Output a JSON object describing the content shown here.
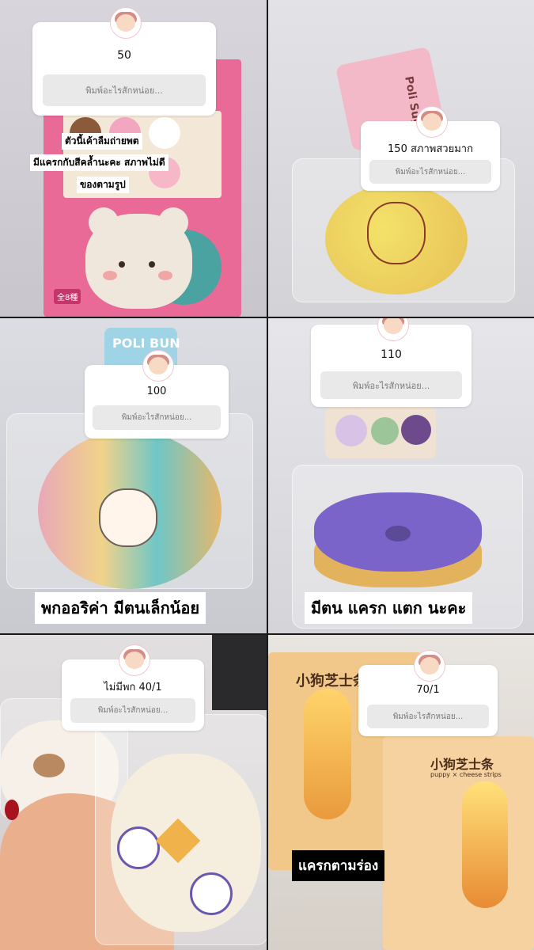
{
  "panels": [
    {
      "answer": "50",
      "placeholder": "พิมพ์อะไรสักหน่อย...",
      "captions": [
        "ตัวนี้เค้าลืมถ่ายพต",
        "มีแครกกับสีคล้ำนะคะ  สภาพไม่ดี",
        "ของตามรูป"
      ]
    },
    {
      "answer": "150 สภาพสวยมาก",
      "placeholder": "พิมพ์อะไรสักหน่อย...",
      "captions": []
    },
    {
      "answer": "100",
      "placeholder": "พิมพ์อะไรสักหน่อย...",
      "captions": [
        "พกออริค่า  มีตนเล็กน้อย"
      ]
    },
    {
      "answer": "110",
      "placeholder": "พิมพ์อะไรสักหน่อย...",
      "captions": [
        "มีตน  แครก  แตก  นะคะ"
      ]
    },
    {
      "answer": "ไม่มีพก 40/1",
      "placeholder": "พิมพ์อะไรสักหน่อย...",
      "captions": []
    },
    {
      "answer": "70/1",
      "placeholder": "พิมพ์อะไรสักหน่อย...",
      "captions": [
        "แครกตามร่อง"
      ]
    }
  ],
  "product_labels": {
    "poli_bun": "POLI BUN",
    "poli_sugar": "Poli Sugar",
    "puppy_cheese_cn": "小狗芝士条",
    "puppy_cheese_en": "puppy × cheese strips",
    "count_badge": "全8種"
  }
}
